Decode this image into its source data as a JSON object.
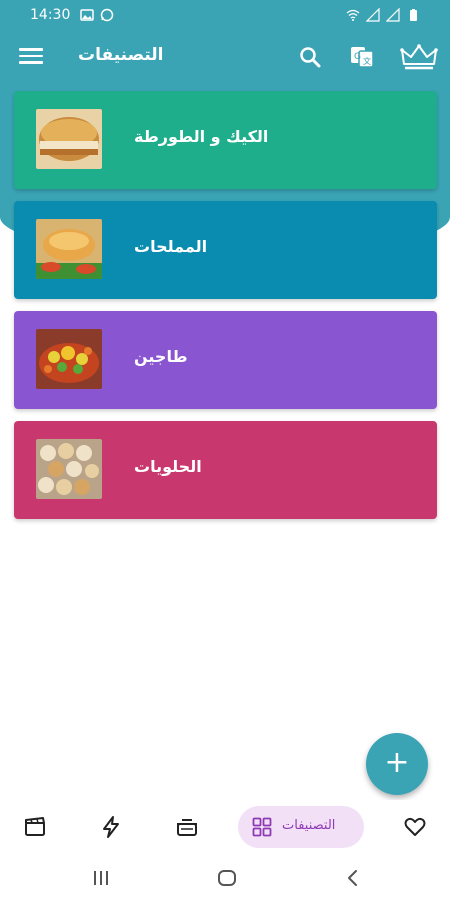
{
  "status_bar": {
    "time": "14:30"
  },
  "app_bar": {
    "title": "التصنيفات"
  },
  "categories": [
    {
      "label": "الكيك و الطورطة",
      "color": "#1fae8c"
    },
    {
      "label": "المملحات",
      "color": "#0a8bb0"
    },
    {
      "label": "طاجين",
      "color": "#8a55d1"
    },
    {
      "label": "الحلويات",
      "color": "#c8376e"
    }
  ],
  "fab": {
    "label": "+"
  },
  "bottom_nav": {
    "active_label": "التصنيفات"
  },
  "colors": {
    "primary": "#3aa4b5",
    "active_pill": "#f2e0f7",
    "active_text": "#8e3ab5"
  }
}
